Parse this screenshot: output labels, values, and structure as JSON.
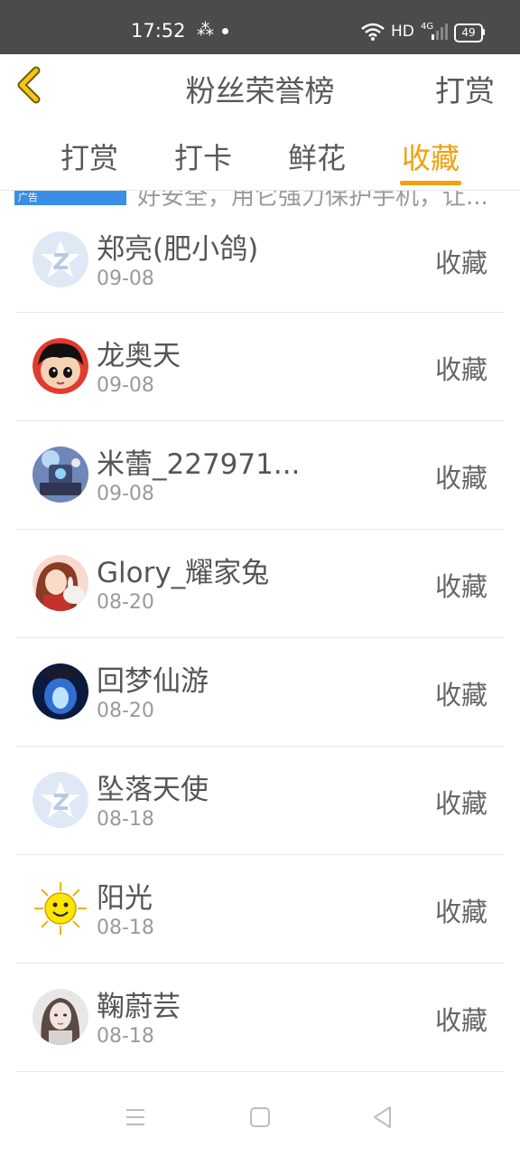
{
  "status_bar": {
    "time": "17:52",
    "hd": "HD",
    "network": "4G",
    "battery": "49"
  },
  "header": {
    "title": "粉丝荣誉榜",
    "right_action": "打赏"
  },
  "tabs": [
    {
      "label": "打赏",
      "active": false
    },
    {
      "label": "打卡",
      "active": false
    },
    {
      "label": "鲜花",
      "active": false
    },
    {
      "label": "收藏",
      "active": true
    }
  ],
  "ad": {
    "badge": "广告",
    "text": "好安全，用它强力保护手机，让..."
  },
  "fans": [
    {
      "name": "郑亮(肥小鸽)",
      "date": "09-08",
      "action": "收藏",
      "avatar": "default-q-avatar"
    },
    {
      "name": "龙奥天",
      "date": "09-08",
      "action": "收藏",
      "avatar": "cartoon-boy-avatar"
    },
    {
      "name": "米蕾_227971...",
      "date": "09-08",
      "action": "收藏",
      "avatar": "robot-avatar"
    },
    {
      "name": "Glory_耀家兔",
      "date": "08-20",
      "action": "收藏",
      "avatar": "girl-bunny-avatar"
    },
    {
      "name": "回梦仙游",
      "date": "08-20",
      "action": "收藏",
      "avatar": "blue-glow-avatar"
    },
    {
      "name": "坠落天使",
      "date": "08-18",
      "action": "收藏",
      "avatar": "default-q-avatar"
    },
    {
      "name": "阳光",
      "date": "08-18",
      "action": "收藏",
      "avatar": "sun-avatar"
    },
    {
      "name": "鞠蔚芸",
      "date": "08-18",
      "action": "收藏",
      "avatar": "woman-photo-avatar"
    }
  ],
  "colors": {
    "accent": "#f2a00c",
    "status_bar": "#4b4b4b",
    "text": "#555555",
    "subtext": "#9a9a9a"
  }
}
